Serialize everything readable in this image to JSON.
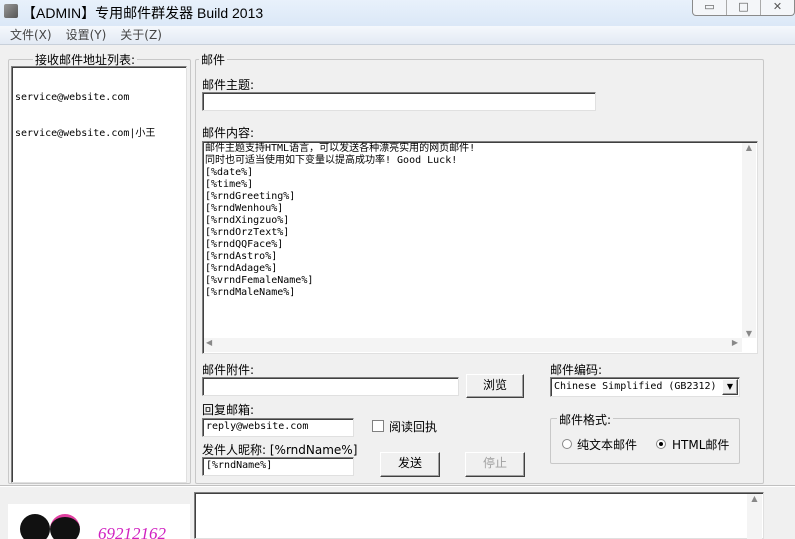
{
  "window": {
    "title": "【ADMIN】专用邮件群发器 Build 2013",
    "controls": [
      "▭",
      "□",
      "✕"
    ]
  },
  "menu": [
    "文件(X)",
    "设置(Y)",
    "关于(Z)"
  ],
  "recipients": {
    "label": "接收邮件地址列表:",
    "items": [
      "service@website.com",
      "service@website.com|小王"
    ]
  },
  "mail": {
    "group_label": "邮件",
    "subject_label": "邮件主题:",
    "subject_value": "",
    "content_label": "邮件内容:",
    "content_lines": [
      "邮件主题支持HTML语言，可以发送各种漂亮实用的网页邮件!",
      "同时也可适当使用如下变量以提高成功率! Good Luck!",
      "[%date%]",
      "[%time%]",
      "[%rndGreeting%]",
      "[%rndWenhou%]",
      "[%rndXingzuo%]",
      "[%rndOrzText%]",
      "[%rndQQFace%]",
      "[%rndAstro%]",
      "[%rndAdage%]",
      "[%vrndFemaleName%]",
      "[%rndMaleName%]"
    ],
    "attachment_label": "邮件附件:",
    "attachment_value": "",
    "browse_label": "浏览",
    "encoding_label": "邮件编码:",
    "encoding_value": "Chinese Simplified (GB2312)",
    "reply_label": "回复邮箱:",
    "reply_value": "reply@website.com",
    "read_receipt_label": "阅读回执",
    "read_receipt_checked": false,
    "nickname_label": "发件人昵称: [%rndName%]",
    "nickname_value": "[%rndName%]",
    "send_label": "发送",
    "stop_label": "停止",
    "format_label": "邮件格式:",
    "format_options": [
      "纯文本邮件",
      "HTML邮件"
    ],
    "format_selected": "HTML邮件"
  },
  "banner": {
    "number": "69212162"
  }
}
